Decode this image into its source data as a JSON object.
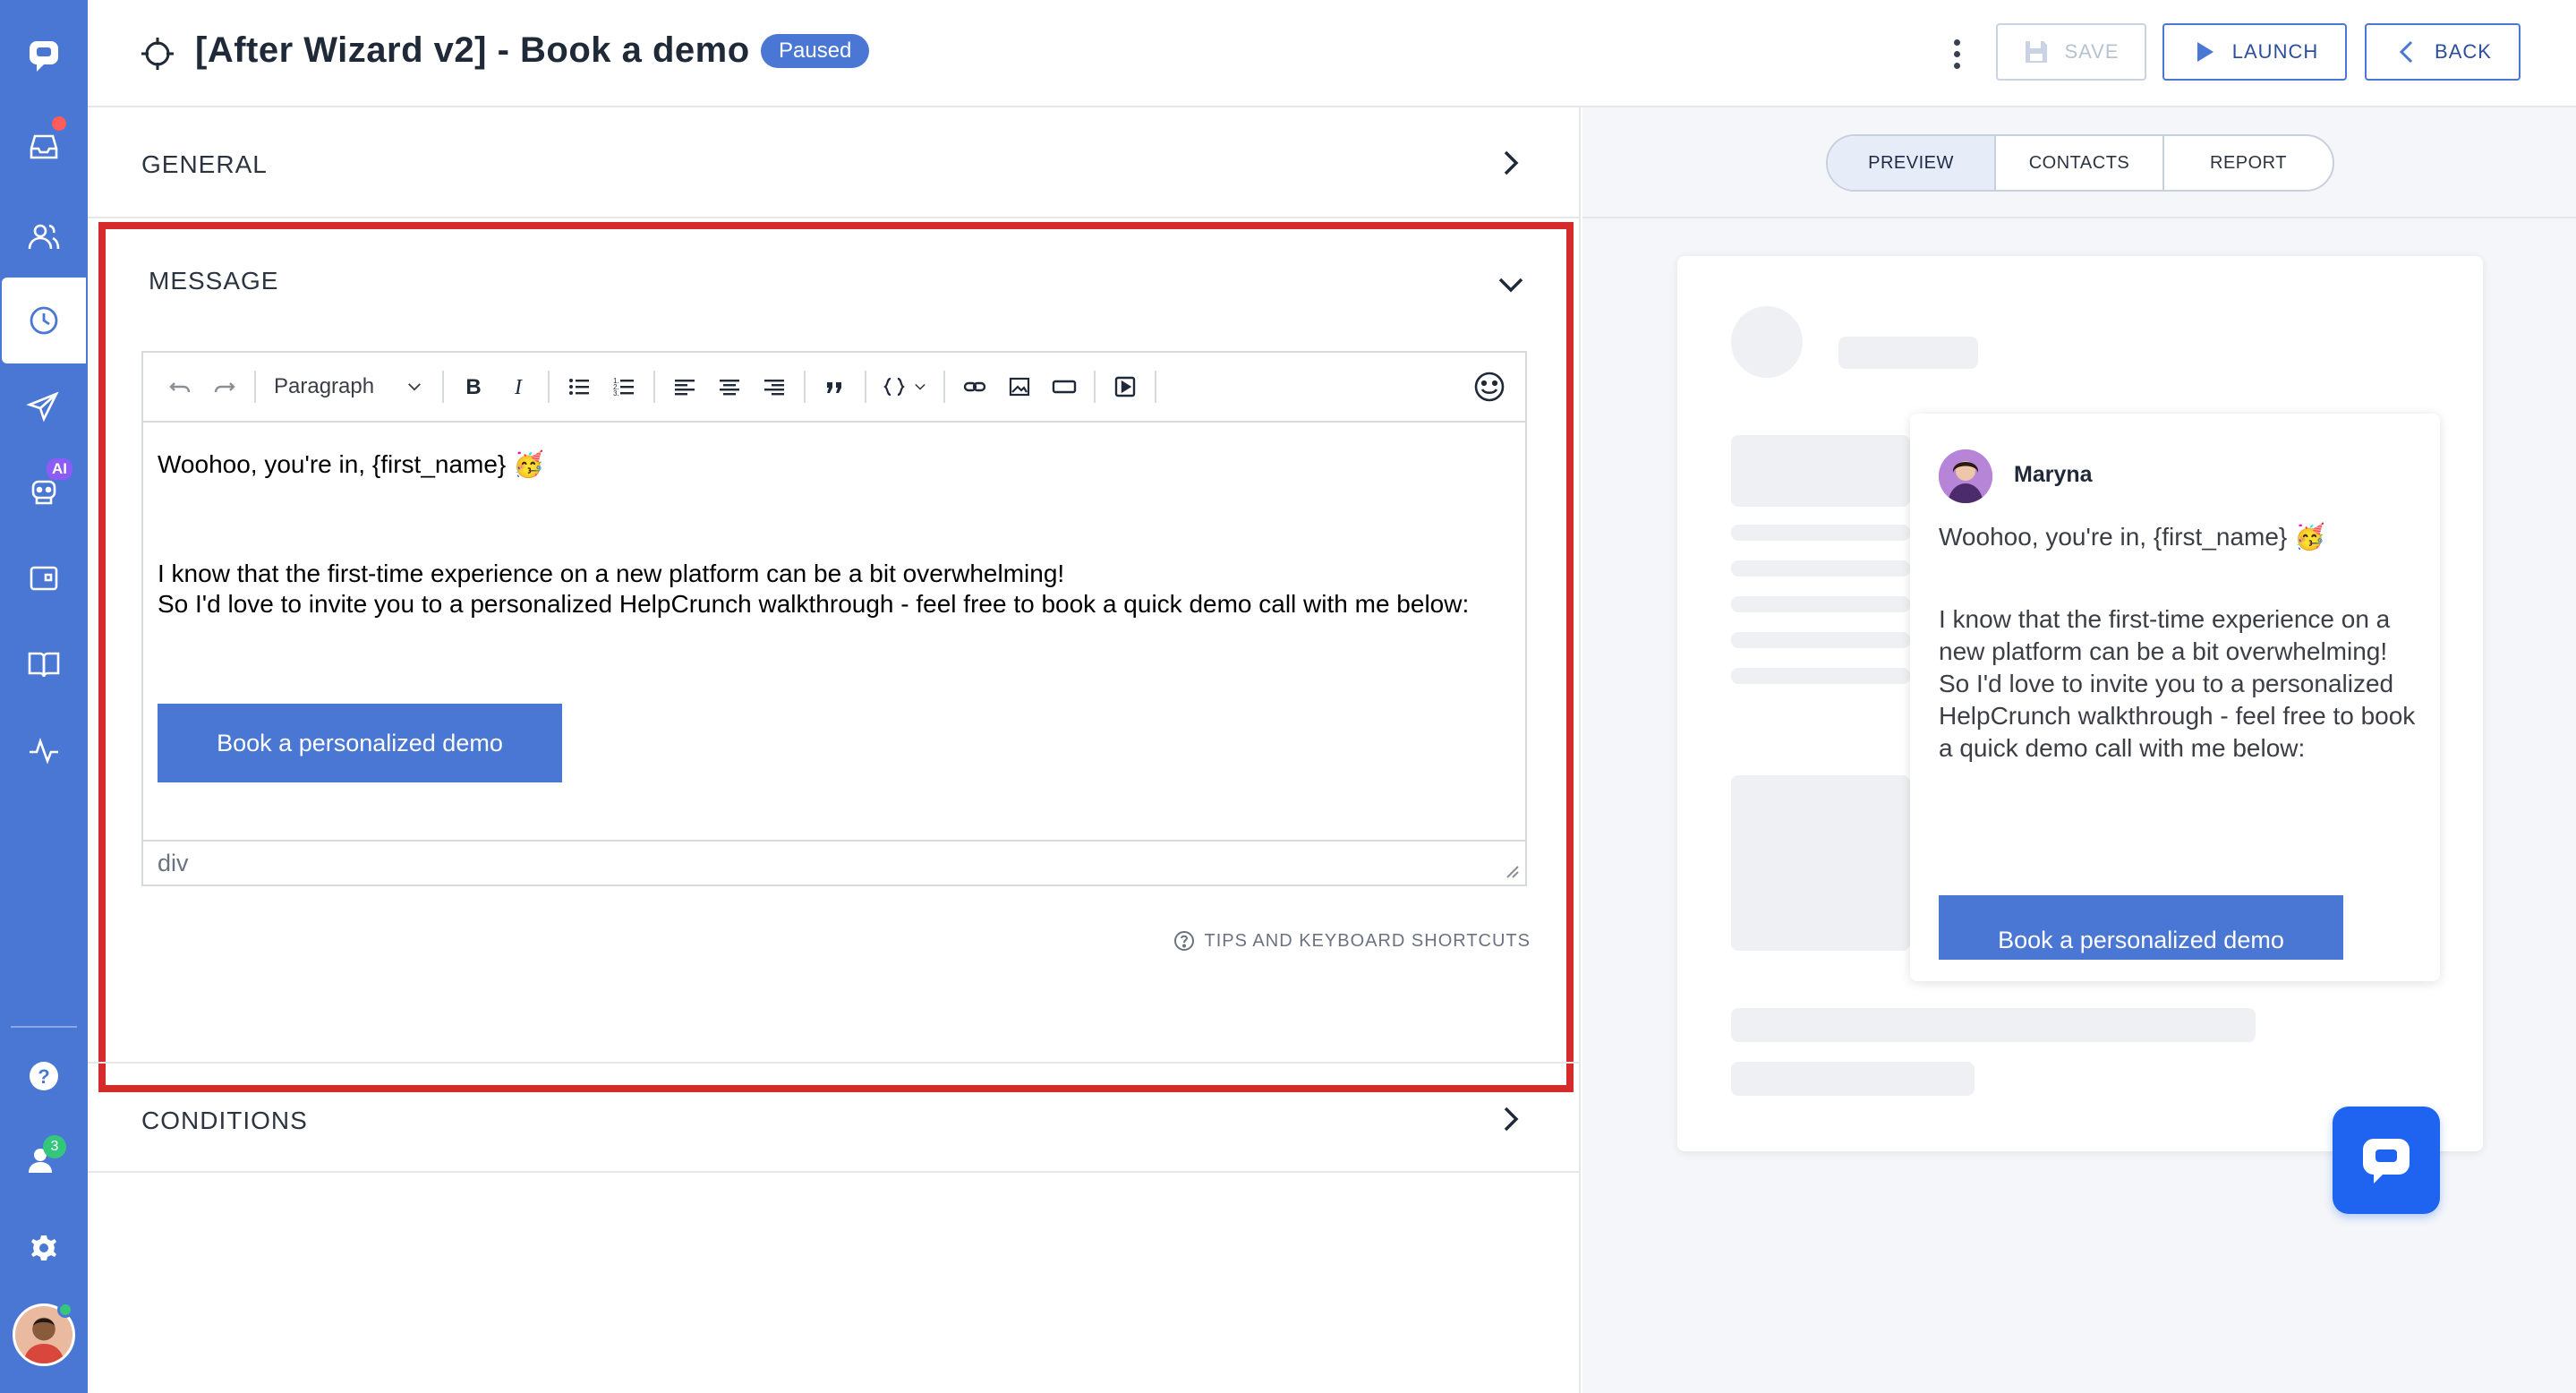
{
  "header": {
    "title": "[After Wizard v2] - Book a demo",
    "status": "Paused",
    "save_label": "SAVE",
    "launch_label": "LAUNCH",
    "back_label": "BACK"
  },
  "sidebar": {
    "ai_badge": "AI",
    "team_count": "3"
  },
  "sections": {
    "general": "GENERAL",
    "message": "MESSAGE",
    "conditions": "CONDITIONS"
  },
  "editor": {
    "block_format": "Paragraph",
    "line1": "Woohoo, you're in, {first_name} 🥳",
    "line2": "I know that the first-time experience on a new platform can be a bit overwhelming!",
    "line3": "So I'd love to invite you to a personalized HelpCrunch walkthrough - feel free to book a quick demo call with me below:",
    "cta_label": "Book a personalized demo",
    "status_path": "div",
    "tips_label": "TIPS AND KEYBOARD SHORTCUTS"
  },
  "preview": {
    "tabs": [
      "PREVIEW",
      "CONTACTS",
      "REPORT"
    ],
    "agent_name": "Maryna",
    "greeting": "Woohoo, you're in, {first_name} 🥳",
    "body": "I know that the first-time experience on a new platform can be a bit overwhelming!\nSo I'd love to invite you to a personalized HelpCrunch walkthrough - feel free to book a quick demo call with me below:",
    "cta_label": "Book a personalized demo"
  },
  "colors": {
    "brand": "#4a77d4",
    "highlight": "#d52b2b",
    "launcher": "#1e64f0"
  }
}
